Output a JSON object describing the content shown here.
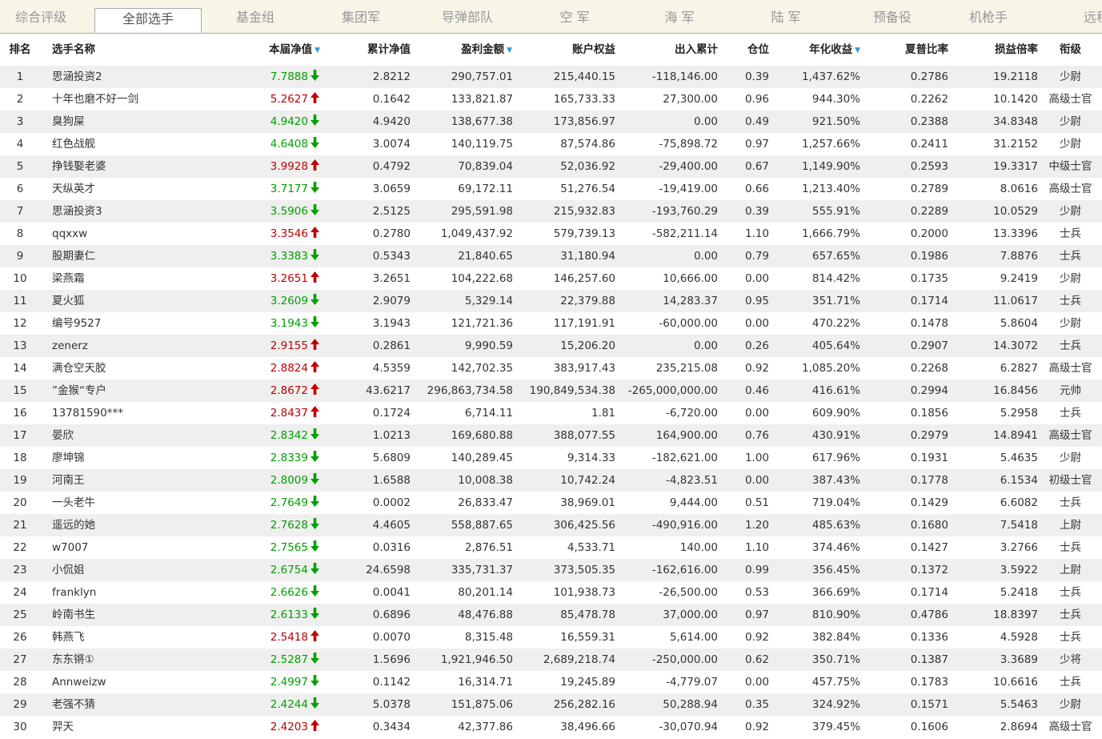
{
  "tabs": [
    "综合评级",
    "全部选手",
    "基金组",
    "集团军",
    "导弹部队",
    "空 军",
    "海 军",
    "陆 军",
    "预备役",
    "机枪手",
    "远程"
  ],
  "active_tab": 1,
  "colors": {
    "up": "#c00000",
    "down": "#00a000",
    "sort": "#2a9bd9",
    "row_alt": "#efefef"
  },
  "headers": {
    "rank": "排名",
    "name": "选手名称",
    "nav": "本届净值",
    "cum": "累计净值",
    "profit": "盈利金额",
    "equity": "账户权益",
    "flow": "出入累计",
    "pos": "仓位",
    "annual": "年化收益",
    "sharpe": "夏普比率",
    "pl": "损益倍率",
    "title": "衔级"
  },
  "rows": [
    {
      "rank": "1",
      "name": "思涵投资2",
      "nav": "7.7888",
      "trend": "down",
      "cum": "2.8212",
      "profit": "290,757.01",
      "equity": "215,440.15",
      "flow": "-118,146.00",
      "pos": "0.39",
      "annual": "1,437.62%",
      "sharpe": "0.2786",
      "pl": "19.2118",
      "title": "少尉"
    },
    {
      "rank": "2",
      "name": "十年也磨不好一剑",
      "nav": "5.2627",
      "trend": "up",
      "cum": "0.1642",
      "profit": "133,821.87",
      "equity": "165,733.33",
      "flow": "27,300.00",
      "pos": "0.96",
      "annual": "944.30%",
      "sharpe": "0.2262",
      "pl": "10.1420",
      "title": "高级士官"
    },
    {
      "rank": "3",
      "name": "臭狗屎",
      "nav": "4.9420",
      "trend": "down",
      "cum": "4.9420",
      "profit": "138,677.38",
      "equity": "173,856.97",
      "flow": "0.00",
      "pos": "0.49",
      "annual": "921.50%",
      "sharpe": "0.2388",
      "pl": "34.8348",
      "title": "少尉"
    },
    {
      "rank": "4",
      "name": "红色战舰",
      "nav": "4.6408",
      "trend": "down",
      "cum": "3.0074",
      "profit": "140,119.75",
      "equity": "87,574.86",
      "flow": "-75,898.72",
      "pos": "0.97",
      "annual": "1,257.66%",
      "sharpe": "0.2411",
      "pl": "31.2152",
      "title": "少尉"
    },
    {
      "rank": "5",
      "name": "挣钱娶老婆",
      "nav": "3.9928",
      "trend": "up",
      "cum": "0.4792",
      "profit": "70,839.04",
      "equity": "52,036.92",
      "flow": "-29,400.00",
      "pos": "0.67",
      "annual": "1,149.90%",
      "sharpe": "0.2593",
      "pl": "19.3317",
      "title": "中级士官"
    },
    {
      "rank": "6",
      "name": "天纵英才",
      "nav": "3.7177",
      "trend": "down",
      "cum": "3.0659",
      "profit": "69,172.11",
      "equity": "51,276.54",
      "flow": "-19,419.00",
      "pos": "0.66",
      "annual": "1,213.40%",
      "sharpe": "0.2789",
      "pl": "8.0616",
      "title": "高级士官"
    },
    {
      "rank": "7",
      "name": "思涵投资3",
      "nav": "3.5906",
      "trend": "down",
      "cum": "2.5125",
      "profit": "295,591.98",
      "equity": "215,932.83",
      "flow": "-193,760.29",
      "pos": "0.39",
      "annual": "555.91%",
      "sharpe": "0.2289",
      "pl": "10.0529",
      "title": "少尉"
    },
    {
      "rank": "8",
      "name": "qqxxw",
      "nav": "3.3546",
      "trend": "up",
      "cum": "0.2780",
      "profit": "1,049,437.92",
      "equity": "579,739.13",
      "flow": "-582,211.14",
      "pos": "1.10",
      "annual": "1,666.79%",
      "sharpe": "0.2000",
      "pl": "13.3396",
      "title": "士兵"
    },
    {
      "rank": "9",
      "name": "股期妻仁",
      "nav": "3.3383",
      "trend": "down",
      "cum": "0.5343",
      "profit": "21,840.65",
      "equity": "31,180.94",
      "flow": "0.00",
      "pos": "0.79",
      "annual": "657.65%",
      "sharpe": "0.1986",
      "pl": "7.8876",
      "title": "士兵"
    },
    {
      "rank": "10",
      "name": "梁燕霜",
      "nav": "3.2651",
      "trend": "up",
      "cum": "3.2651",
      "profit": "104,222.68",
      "equity": "146,257.60",
      "flow": "10,666.00",
      "pos": "0.00",
      "annual": "814.42%",
      "sharpe": "0.1735",
      "pl": "9.2419",
      "title": "少尉"
    },
    {
      "rank": "11",
      "name": "夏火狐",
      "nav": "3.2609",
      "trend": "down",
      "cum": "2.9079",
      "profit": "5,329.14",
      "equity": "22,379.88",
      "flow": "14,283.37",
      "pos": "0.95",
      "annual": "351.71%",
      "sharpe": "0.1714",
      "pl": "11.0617",
      "title": "士兵"
    },
    {
      "rank": "12",
      "name": "编号9527",
      "nav": "3.1943",
      "trend": "down",
      "cum": "3.1943",
      "profit": "121,721.36",
      "equity": "117,191.91",
      "flow": "-60,000.00",
      "pos": "0.00",
      "annual": "470.22%",
      "sharpe": "0.1478",
      "pl": "5.8604",
      "title": "少尉"
    },
    {
      "rank": "13",
      "name": "zenerz",
      "nav": "2.9155",
      "trend": "up",
      "cum": "0.2861",
      "profit": "9,990.59",
      "equity": "15,206.20",
      "flow": "0.00",
      "pos": "0.26",
      "annual": "405.64%",
      "sharpe": "0.2907",
      "pl": "14.3072",
      "title": "士兵"
    },
    {
      "rank": "14",
      "name": "满仓空天胶",
      "nav": "2.8824",
      "trend": "up",
      "cum": "4.5359",
      "profit": "142,702.35",
      "equity": "383,917.43",
      "flow": "235,215.08",
      "pos": "0.92",
      "annual": "1,085.20%",
      "sharpe": "0.2268",
      "pl": "6.2827",
      "title": "高级士官"
    },
    {
      "rank": "15",
      "name": "”金猴“专户",
      "nav": "2.8672",
      "trend": "up",
      "cum": "43.6217",
      "profit": "296,863,734.58",
      "equity": "190,849,534.38",
      "flow": "-265,000,000.00",
      "pos": "0.46",
      "annual": "416.61%",
      "sharpe": "0.2994",
      "pl": "16.8456",
      "title": "元帅"
    },
    {
      "rank": "16",
      "name": "13781590***",
      "nav": "2.8437",
      "trend": "up",
      "cum": "0.1724",
      "profit": "6,714.11",
      "equity": "1.81",
      "flow": "-6,720.00",
      "pos": "0.00",
      "annual": "609.90%",
      "sharpe": "0.1856",
      "pl": "5.2958",
      "title": "士兵"
    },
    {
      "rank": "17",
      "name": "晏欣",
      "nav": "2.8342",
      "trend": "down",
      "cum": "1.0213",
      "profit": "169,680.88",
      "equity": "388,077.55",
      "flow": "164,900.00",
      "pos": "0.76",
      "annual": "430.91%",
      "sharpe": "0.2979",
      "pl": "14.8941",
      "title": "高级士官"
    },
    {
      "rank": "18",
      "name": "廖坤锦",
      "nav": "2.8339",
      "trend": "down",
      "cum": "5.6809",
      "profit": "140,289.45",
      "equity": "9,314.33",
      "flow": "-182,621.00",
      "pos": "1.00",
      "annual": "617.96%",
      "sharpe": "0.1931",
      "pl": "5.4635",
      "title": "少尉"
    },
    {
      "rank": "19",
      "name": "河南王",
      "nav": "2.8009",
      "trend": "down",
      "cum": "1.6588",
      "profit": "10,008.38",
      "equity": "10,742.24",
      "flow": "-4,823.51",
      "pos": "0.00",
      "annual": "387.43%",
      "sharpe": "0.1778",
      "pl": "6.1534",
      "title": "初级士官"
    },
    {
      "rank": "20",
      "name": "一头老牛",
      "nav": "2.7649",
      "trend": "down",
      "cum": "0.0002",
      "profit": "26,833.47",
      "equity": "38,969.01",
      "flow": "9,444.00",
      "pos": "0.51",
      "annual": "719.04%",
      "sharpe": "0.1429",
      "pl": "6.6082",
      "title": "士兵"
    },
    {
      "rank": "21",
      "name": "遥远的她",
      "nav": "2.7628",
      "trend": "down",
      "cum": "4.4605",
      "profit": "558,887.65",
      "equity": "306,425.56",
      "flow": "-490,916.00",
      "pos": "1.20",
      "annual": "485.63%",
      "sharpe": "0.1680",
      "pl": "7.5418",
      "title": "上尉"
    },
    {
      "rank": "22",
      "name": "w7007",
      "nav": "2.7565",
      "trend": "down",
      "cum": "0.0316",
      "profit": "2,876.51",
      "equity": "4,533.71",
      "flow": "140.00",
      "pos": "1.10",
      "annual": "374.46%",
      "sharpe": "0.1427",
      "pl": "3.2766",
      "title": "士兵"
    },
    {
      "rank": "23",
      "name": "小侃姐",
      "nav": "2.6754",
      "trend": "down",
      "cum": "24.6598",
      "profit": "335,731.37",
      "equity": "373,505.35",
      "flow": "-162,616.00",
      "pos": "0.99",
      "annual": "356.45%",
      "sharpe": "0.1372",
      "pl": "3.5922",
      "title": "上尉"
    },
    {
      "rank": "24",
      "name": "franklyn",
      "nav": "2.6626",
      "trend": "down",
      "cum": "0.0041",
      "profit": "80,201.14",
      "equity": "101,938.73",
      "flow": "-26,500.00",
      "pos": "0.53",
      "annual": "366.69%",
      "sharpe": "0.1714",
      "pl": "5.2418",
      "title": "士兵"
    },
    {
      "rank": "25",
      "name": "岭南书生",
      "nav": "2.6133",
      "trend": "down",
      "cum": "0.6896",
      "profit": "48,476.88",
      "equity": "85,478.78",
      "flow": "37,000.00",
      "pos": "0.97",
      "annual": "810.90%",
      "sharpe": "0.4786",
      "pl": "18.8397",
      "title": "士兵"
    },
    {
      "rank": "26",
      "name": "韩燕飞",
      "nav": "2.5418",
      "trend": "up",
      "cum": "0.0070",
      "profit": "8,315.48",
      "equity": "16,559.31",
      "flow": "5,614.00",
      "pos": "0.92",
      "annual": "382.84%",
      "sharpe": "0.1336",
      "pl": "4.5928",
      "title": "士兵"
    },
    {
      "rank": "27",
      "name": "东东锵①",
      "nav": "2.5287",
      "trend": "down",
      "cum": "1.5696",
      "profit": "1,921,946.50",
      "equity": "2,689,218.74",
      "flow": "-250,000.00",
      "pos": "0.62",
      "annual": "350.71%",
      "sharpe": "0.1387",
      "pl": "3.3689",
      "title": "少将"
    },
    {
      "rank": "28",
      "name": "Annweizw",
      "nav": "2.4997",
      "trend": "down",
      "cum": "0.1142",
      "profit": "16,314.71",
      "equity": "19,245.89",
      "flow": "-4,779.07",
      "pos": "0.00",
      "annual": "457.75%",
      "sharpe": "0.1783",
      "pl": "10.6616",
      "title": "士兵"
    },
    {
      "rank": "29",
      "name": "老强不猜",
      "nav": "2.4244",
      "trend": "down",
      "cum": "5.0378",
      "profit": "151,875.06",
      "equity": "256,282.16",
      "flow": "50,288.94",
      "pos": "0.35",
      "annual": "324.92%",
      "sharpe": "0.1571",
      "pl": "5.5463",
      "title": "少尉"
    },
    {
      "rank": "30",
      "name": "羿天",
      "nav": "2.4203",
      "trend": "up",
      "cum": "0.3434",
      "profit": "42,377.86",
      "equity": "38,496.66",
      "flow": "-30,070.94",
      "pos": "0.92",
      "annual": "379.45%",
      "sharpe": "0.1606",
      "pl": "2.8694",
      "title": "高级士官"
    }
  ]
}
